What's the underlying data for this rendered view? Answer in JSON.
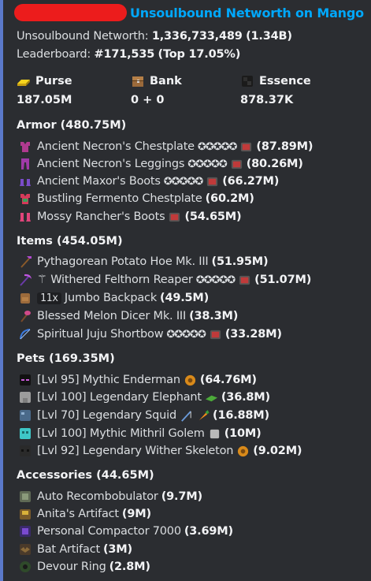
{
  "header": {
    "title": "Unsoulbound Networth on Mango"
  },
  "stats": {
    "networth_label": "Unsoulbound Networth:",
    "networth_value": "1,336,733,489",
    "networth_short": "(1.34B)",
    "leaderboard_label": "Leaderboard:",
    "leaderboard_rank": "#171,535",
    "leaderboard_pct": "(Top 17.05%)"
  },
  "summary": [
    {
      "label": "Purse",
      "value": "187.05M",
      "icon": "gold-ingot-icon"
    },
    {
      "label": "Bank",
      "value": "0 + 0",
      "icon": "bank-chest-icon"
    },
    {
      "label": "Essence",
      "value": "878.37K",
      "icon": "wither-essence-icon"
    }
  ],
  "sections": {
    "armor": {
      "title": "Armor (480.75M)",
      "items": [
        {
          "name": "Ancient Necron's Chestplate",
          "stars": "✪✪✪✪✪",
          "value": "(87.89M)"
        },
        {
          "name": "Ancient Necron's Leggings",
          "stars": "✪✪✪✪✪",
          "value": "(80.26M)"
        },
        {
          "name": "Ancient Maxor's Boots",
          "stars": "✪✪✪✪✪",
          "value": "(66.27M)"
        },
        {
          "name": "Bustling Fermento Chestplate",
          "value": "(60.2M)"
        },
        {
          "name": "Mossy Rancher's Boots",
          "value": "(54.65M)"
        }
      ]
    },
    "items": {
      "title": "Items (454.05M)",
      "entries": [
        {
          "name": "Pythagorean Potato Hoe Mk. III",
          "value": "(51.95M)"
        },
        {
          "name": "⚚ Withered Felthorn Reaper",
          "stars": "✪✪✪✪✪",
          "value": "(51.07M)"
        },
        {
          "badge": "11x",
          "name": "Jumbo Backpack",
          "value": "(49.5M)"
        },
        {
          "name": "Blessed Melon Dicer Mk. III",
          "value": "(38.3M)"
        },
        {
          "name": "Spiritual Juju Shortbow",
          "stars": "✪✪✪✪✪",
          "value": "(33.28M)"
        }
      ]
    },
    "pets": {
      "title": "Pets (169.35M)",
      "entries": [
        {
          "name": "[Lvl 95] Mythic Enderman",
          "value": "(64.76M)"
        },
        {
          "name": "[Lvl 100] Legendary Elephant",
          "value": "(36.8M)"
        },
        {
          "name": "[Lvl 70] Legendary Squid",
          "value": "(16.88M)"
        },
        {
          "name": "[Lvl 100] Mythic Mithril Golem",
          "value": "(10M)"
        },
        {
          "name": "[Lvl 92] Legendary Wither Skeleton",
          "value": "(9.02M)"
        }
      ]
    },
    "accessories": {
      "title": "Accessories (44.65M)",
      "entries": [
        {
          "name": "Auto Recombobulator",
          "value": "(9.7M)"
        },
        {
          "name": "Anita's Artifact",
          "value": "(9M)"
        },
        {
          "name": "Personal Compactor 7000",
          "value": "(3.69M)"
        },
        {
          "name": "Bat Artifact",
          "value": "(3M)"
        },
        {
          "name": "Devour Ring",
          "value": "(2.8M)"
        }
      ]
    }
  },
  "colors": {
    "accent_bar": "#5b79c9",
    "title_link": "#00a8fc",
    "background": "#2b2d31",
    "redaction": "#ec1c1c"
  }
}
